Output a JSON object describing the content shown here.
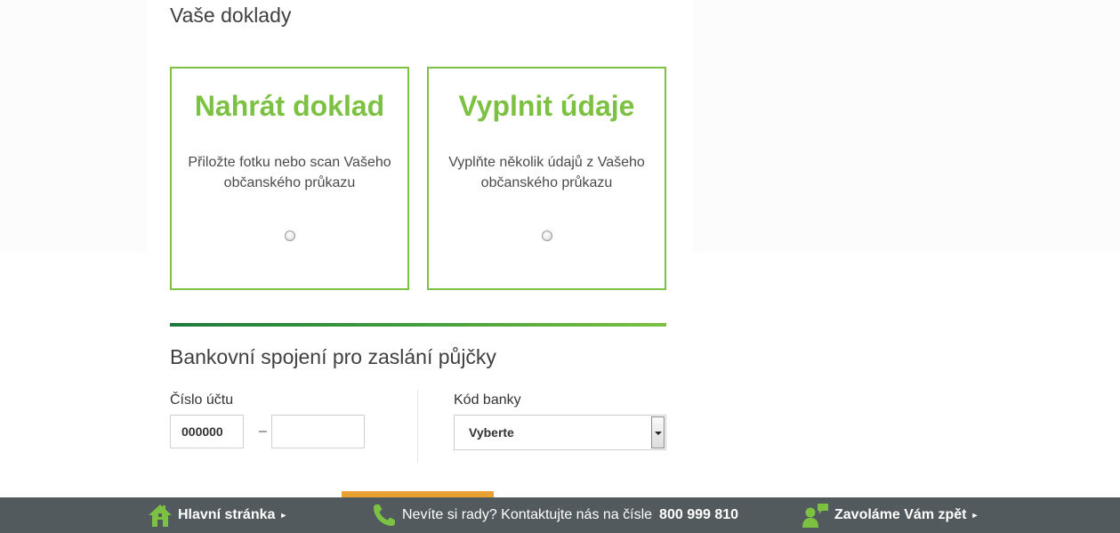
{
  "documents": {
    "heading": "Vaše doklady",
    "upload_card": {
      "title": "Nahrát doklad",
      "desc_line1": "Přiložte fotku nebo scan Vašeho",
      "desc_line2": "občanského průkazu"
    },
    "fill_card": {
      "title": "Vyplnit údaje",
      "desc_line1": "Vyplňte několik údajů z Vašeho",
      "desc_line2": "občanského průkazu"
    }
  },
  "bank": {
    "heading": "Bankovní spojení pro zaslání půjčky",
    "account_label": "Číslo účtu",
    "account_prefix_value": "000000",
    "account_separator": "–",
    "account_number_value": "",
    "bank_code_label": "Kód banky",
    "bank_code_selected": "Vyberte"
  },
  "footer": {
    "home_label": "Hlavní stránka",
    "help_text": "Nevíte si rady? Kontaktujte nás na čísle",
    "phone_number": "800 999 810",
    "callback_label": "Zavoláme Vám zpět",
    "caret": "►"
  },
  "colors": {
    "accent_green": "#7cc142",
    "dark_green": "#1e7a3c",
    "footer_bg": "#525a5d",
    "orange": "#e8a131"
  },
  "icons": {
    "home": "home-icon",
    "phone": "phone-icon",
    "callback": "callback-person-icon"
  }
}
